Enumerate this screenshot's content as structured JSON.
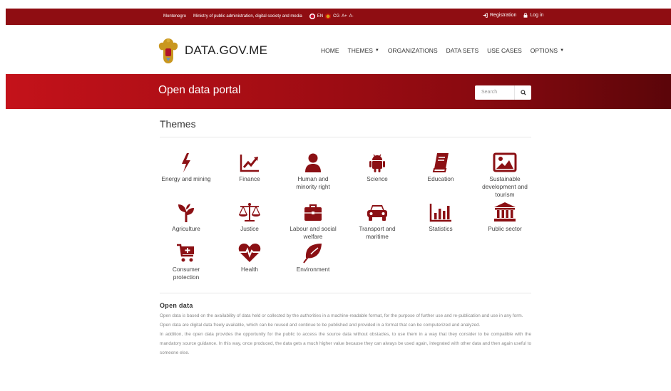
{
  "topbar": {
    "country": "Montenegro",
    "ministry": "Ministry of public administration, digital society and media",
    "lang_en": "EN",
    "lang_cg": "CG",
    "font_up": "A+",
    "font_down": "A-",
    "registration": "Registration",
    "login": "Log in"
  },
  "header": {
    "brand": "DATA.GOV.ME",
    "nav": {
      "home": "HOME",
      "themes": "THEMES",
      "organizations": "ORGANIZATIONS",
      "datasets": "DATA SETS",
      "usecases": "USE CASES",
      "options": "OPTIONS"
    }
  },
  "banner": {
    "title": "Open data portal",
    "search_placeholder": "Search"
  },
  "themes": {
    "title": "Themes",
    "items": [
      {
        "label": "Energy and mining",
        "icon": "bolt-icon"
      },
      {
        "label": "Finance",
        "icon": "chart-line-icon"
      },
      {
        "label": "Human and minority right",
        "icon": "user-icon"
      },
      {
        "label": "Science",
        "icon": "android-icon"
      },
      {
        "label": "Education",
        "icon": "book-icon"
      },
      {
        "label": "Sustainable development and tourism",
        "icon": "image-icon"
      },
      {
        "label": "Agriculture",
        "icon": "seedling-icon"
      },
      {
        "label": "Justice",
        "icon": "scale-icon"
      },
      {
        "label": "Labour and social welfare",
        "icon": "briefcase-icon"
      },
      {
        "label": "Transport and maritime",
        "icon": "car-icon"
      },
      {
        "label": "Statistics",
        "icon": "bar-chart-icon"
      },
      {
        "label": "Public sector",
        "icon": "bank-icon"
      },
      {
        "label": "Consumer protection",
        "icon": "cart-icon"
      },
      {
        "label": "Health",
        "icon": "heartbeat-icon"
      },
      {
        "label": "Environment",
        "icon": "leaf-icon"
      }
    ]
  },
  "open_data": {
    "title": "Open data",
    "p1": "Open data is based on the availability of data held or collected by the authorities in a machine-readable format, for the purpose of further use and re-publication and use in any form.",
    "p2": "Open data are digital data freely available, which can be reused and continue to be published and provided in a format that can be computerized and analyzed.",
    "p3": "In addition, the open data provides the opportunity for the public to access the source data without obstacles, to use them in a way that they consider to be compatible with the mandatory source guidance. In this way, once produced, the data gets a much higher value because they can always be used again, integrated with other data and then again useful to someone else."
  },
  "colors": {
    "accent": "#8f0d12",
    "icon": "#8b1014",
    "banner_start": "#c4121a",
    "banner_end": "#5b0509"
  }
}
